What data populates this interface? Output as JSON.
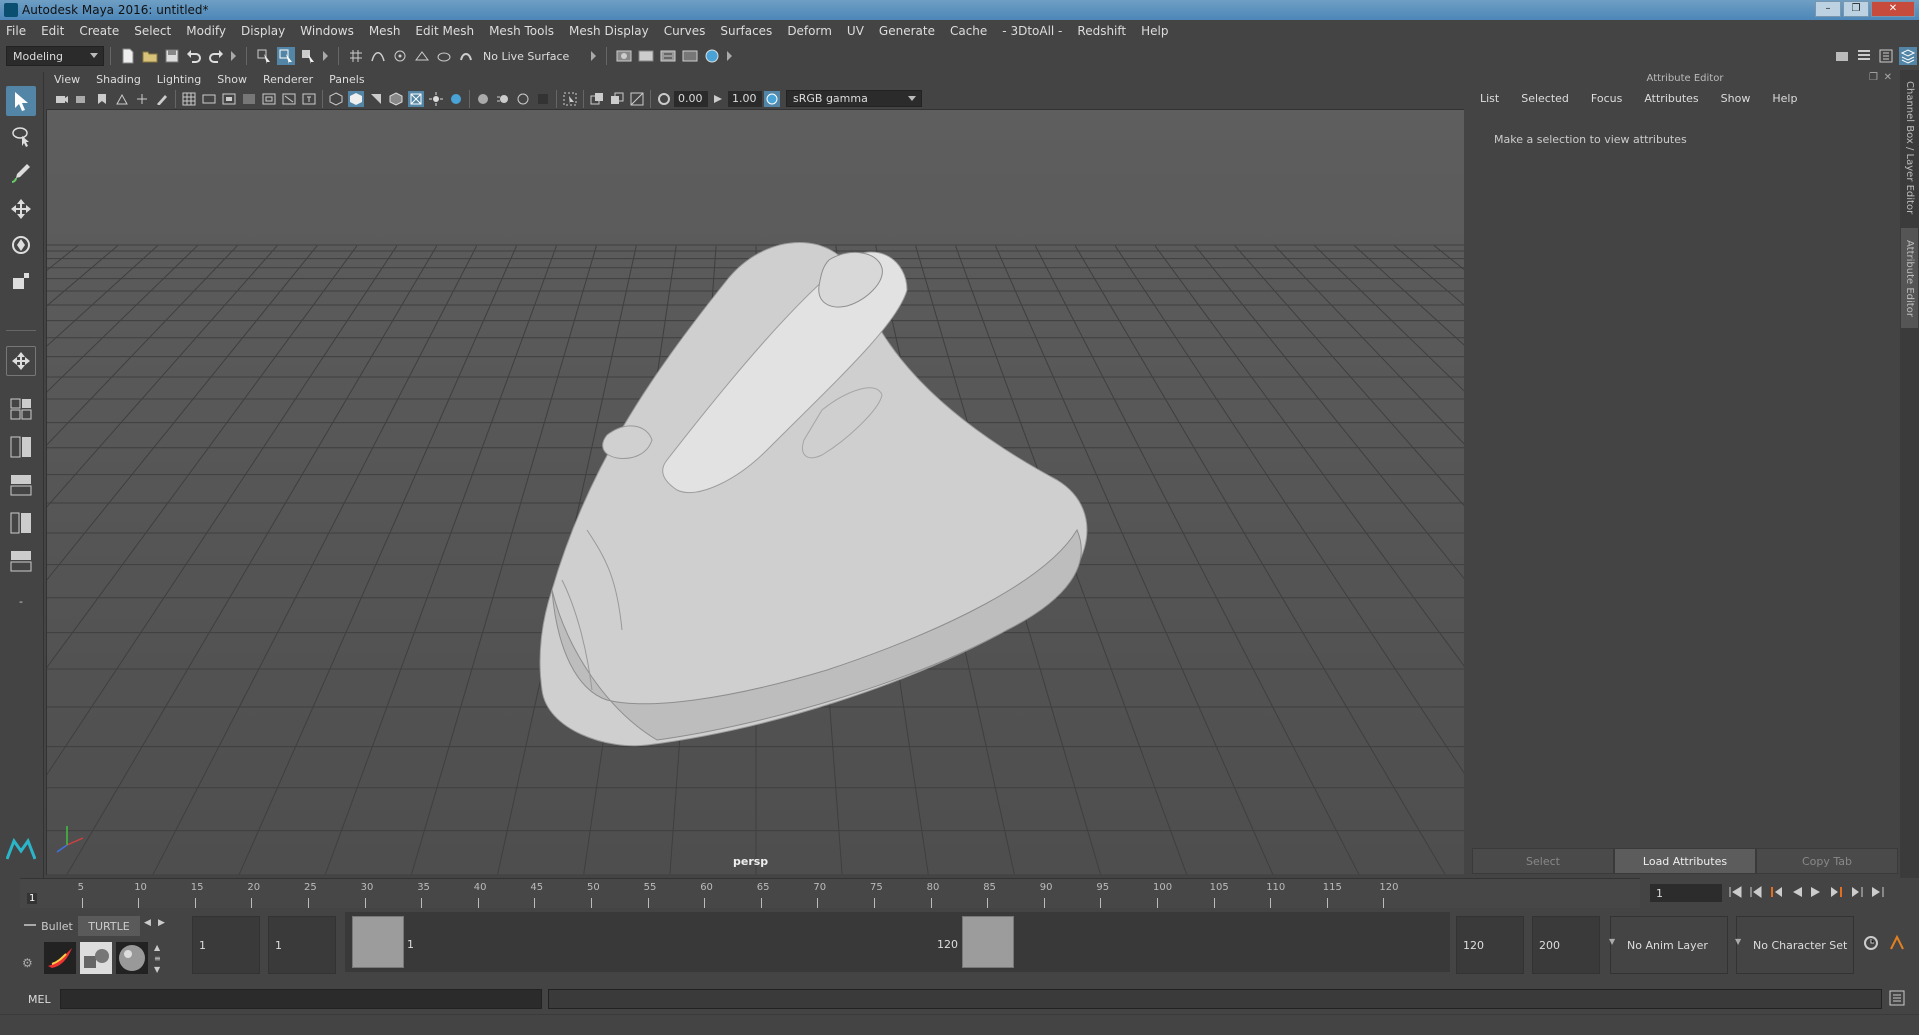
{
  "window": {
    "title": "Autodesk Maya 2016: untitled*",
    "controls": [
      "–",
      "❐",
      "✕"
    ]
  },
  "menubar": [
    "File",
    "Edit",
    "Create",
    "Select",
    "Modify",
    "Display",
    "Windows",
    "Mesh",
    "Edit Mesh",
    "Mesh Tools",
    "Mesh Display",
    "Curves",
    "Surfaces",
    "Deform",
    "UV",
    "Generate",
    "Cache",
    "- 3DtoAll -",
    "Redshift",
    "Help"
  ],
  "toolbar": {
    "menu_set": "Modeling",
    "live_surface": "No Live Surface"
  },
  "viewport": {
    "menu": [
      "View",
      "Shading",
      "Lighting",
      "Show",
      "Renderer",
      "Panels"
    ],
    "exposure": "0.00",
    "gamma": "1.00",
    "color_space": "sRGB gamma",
    "camera_label": "persp"
  },
  "attribute_editor": {
    "header": "Attribute Editor",
    "menu": [
      "List",
      "Selected",
      "Focus",
      "Attributes",
      "Show",
      "Help"
    ],
    "message": "Make a selection to view attributes",
    "buttons": [
      "Select",
      "Load Attributes",
      "Copy Tab"
    ],
    "side_tabs": [
      "Channel Box / Layer Editor",
      "Attribute Editor"
    ]
  },
  "time_slider": {
    "ticks": [
      "5",
      "10",
      "15",
      "20",
      "25",
      "30",
      "35",
      "40",
      "45",
      "50",
      "55",
      "60",
      "65",
      "70",
      "75",
      "80",
      "85",
      "90",
      "95",
      "100",
      "105",
      "110",
      "115",
      "120"
    ],
    "current_marker": "1",
    "current_frame": "1"
  },
  "range_slider": {
    "shelf_tabs": [
      "Bullet",
      "TURTLE"
    ],
    "start_time": "1",
    "playback_start": "1",
    "range_start_label": "1",
    "range_end_label": "120",
    "playback_end": "120",
    "end_time": "200",
    "anim_layer": "No Anim Layer",
    "character_set": "No Character Set"
  },
  "command_line": {
    "label": "MEL"
  }
}
